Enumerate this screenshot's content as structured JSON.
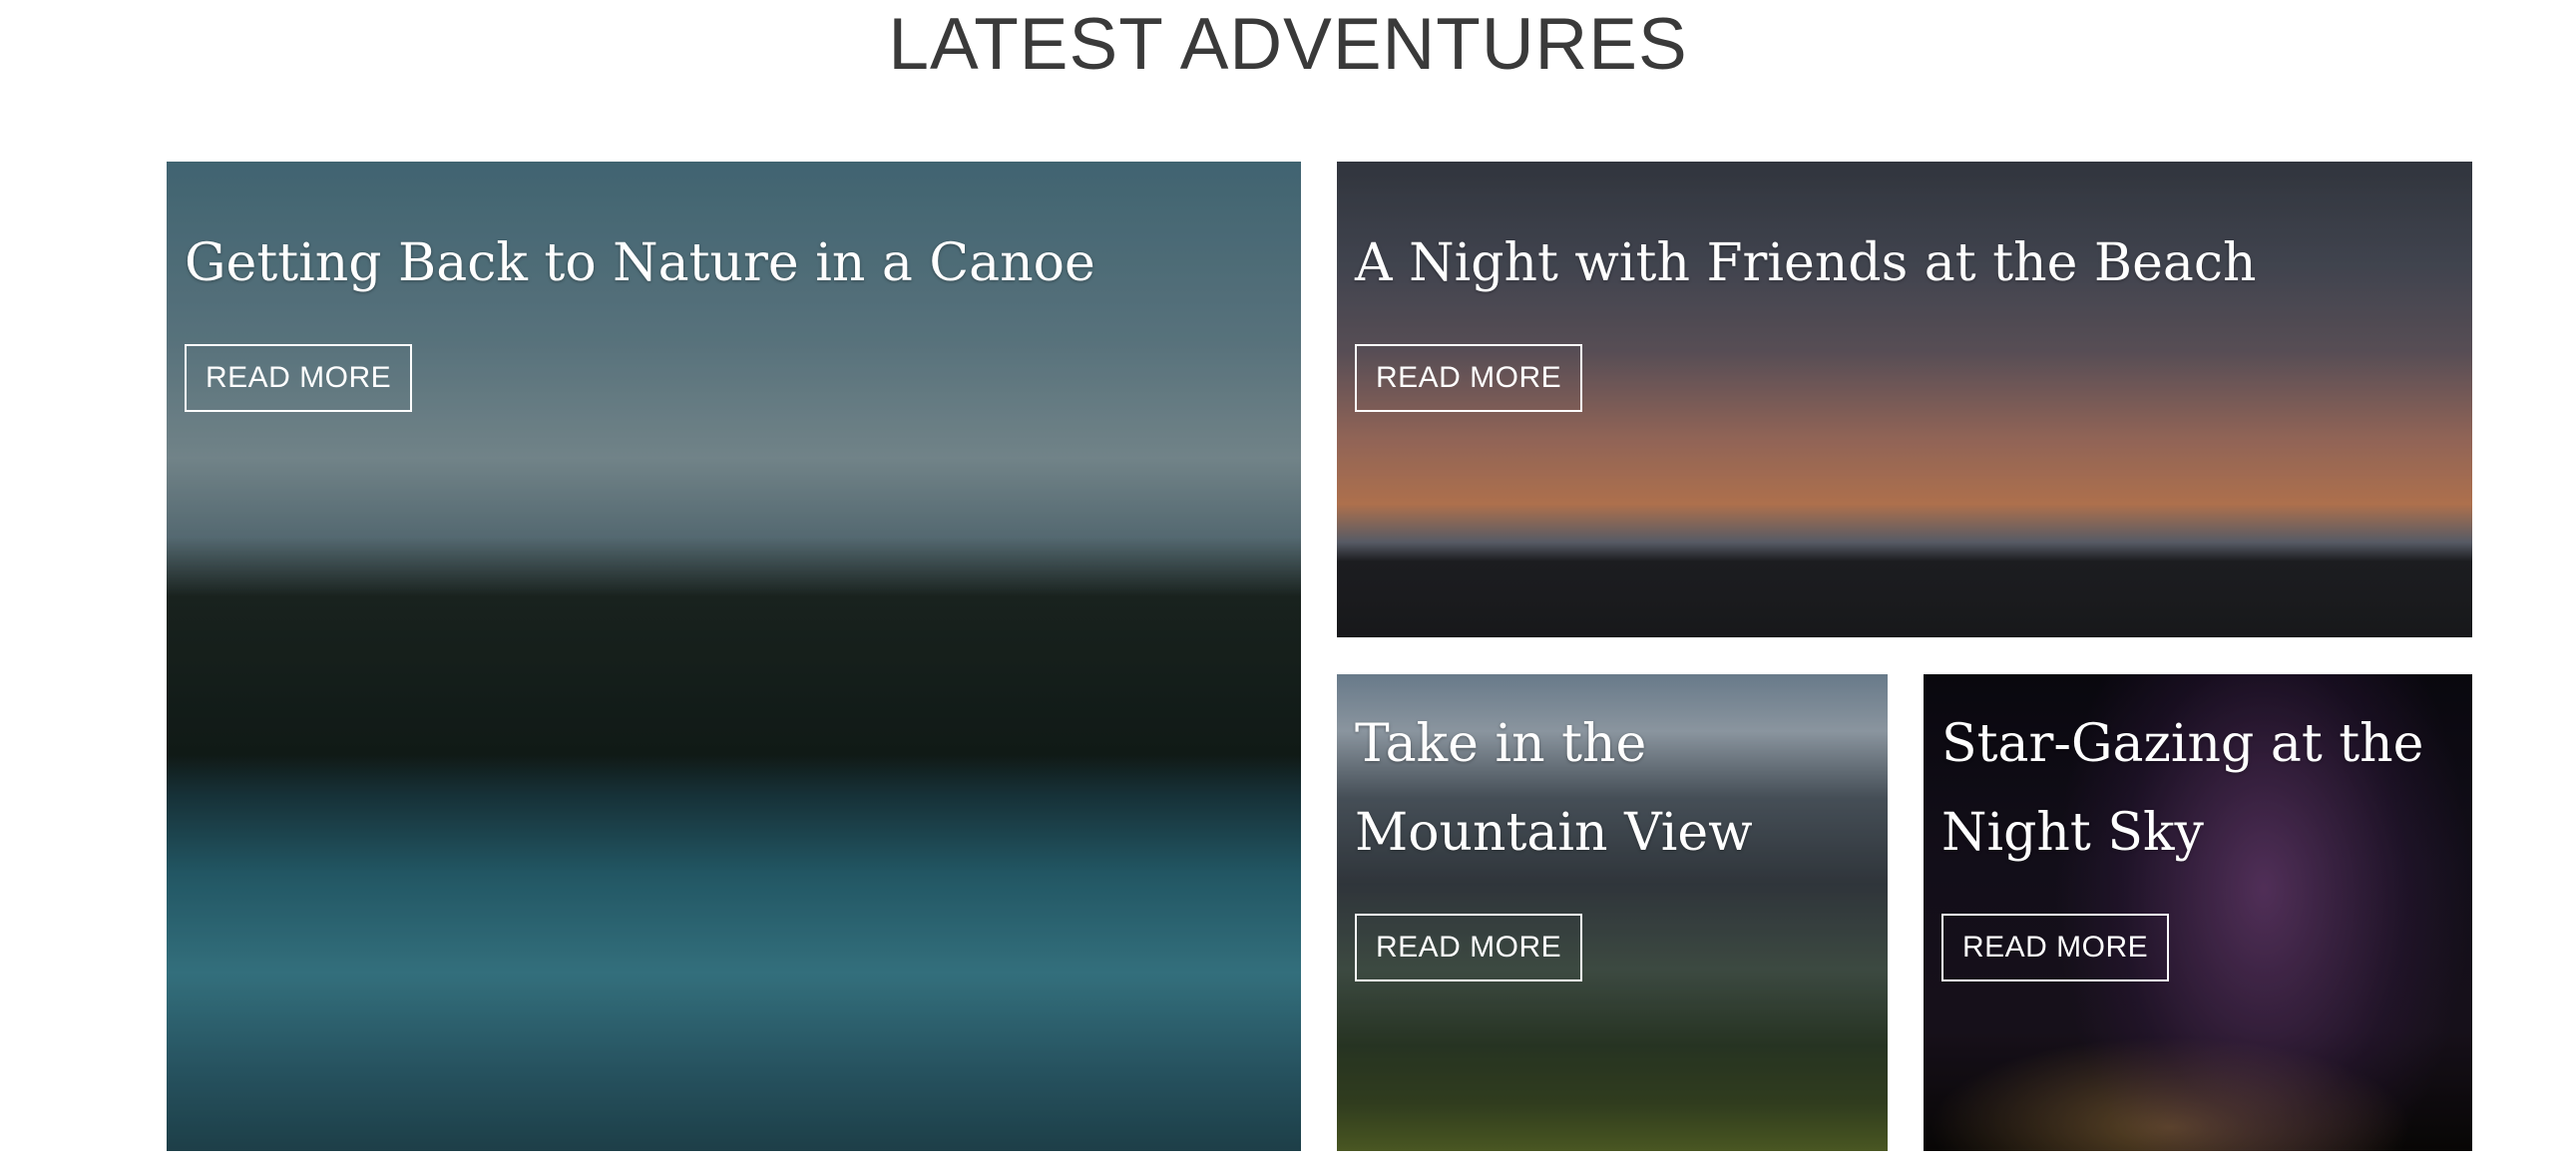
{
  "section": {
    "title": "LATEST ADVENTURES"
  },
  "cards": [
    {
      "title": "Getting Back to Nature in a Canoe",
      "button": "READ MORE"
    },
    {
      "title": "A Night with Friends at the Beach",
      "button": "READ MORE"
    },
    {
      "title_line1": "Take in the",
      "title_line2": "Mountain View",
      "button": "READ MORE"
    },
    {
      "title_line1": "Star-Gazing at the",
      "title_line2": "Night Sky",
      "button": "READ MORE"
    }
  ]
}
